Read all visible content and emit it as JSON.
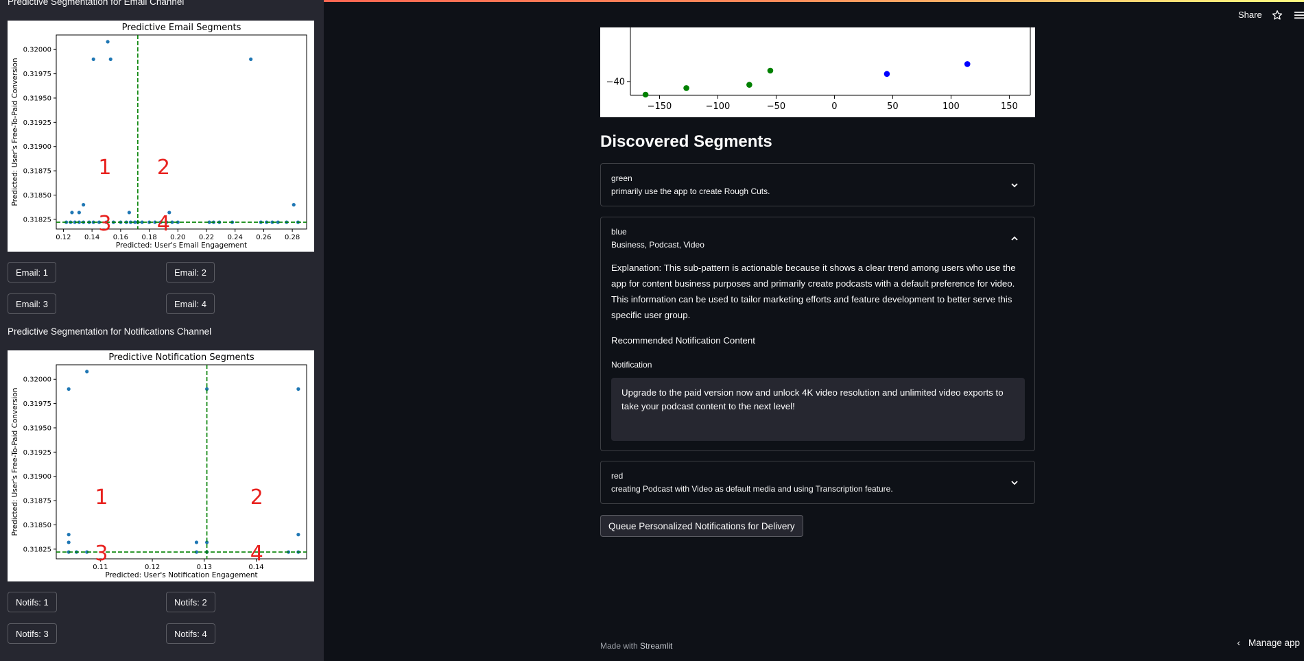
{
  "sidebar": {
    "email_title": "Predictive Segmentation for Email Channel",
    "notif_title": "Predictive Segmentation for Notifications Channel",
    "email_buttons": [
      "Email: 1",
      "Email: 2",
      "Email: 3",
      "Email: 4"
    ],
    "notif_buttons": [
      "Notifs: 1",
      "Notifs: 2",
      "Notifs: 3",
      "Notifs: 4"
    ]
  },
  "header": {
    "share_label": "Share",
    "star_icon": "star-icon",
    "menu_icon": "hamburger-menu-icon"
  },
  "main": {
    "heading": "Discovered Segments",
    "segments": [
      {
        "name": "green",
        "summary": "primarily use the app to create Rough Cuts.",
        "expanded": false
      },
      {
        "name": "blue",
        "summary": "Business, Podcast, Video",
        "expanded": true,
        "explanation": "Explanation: This sub-pattern is actionable because it shows a clear trend among users who use the app for content business purposes and primarily create podcasts with a default preference for video. This information can be used to tailor marketing efforts and feature development to better serve this specific user group.",
        "recommended_label": "Recommended Notification Content",
        "notification_label": "Notification",
        "notification_text": " Upgrade to the paid version now and unlock 4K video resolution and unlimited video exports to take your podcast content to the next level!"
      },
      {
        "name": "red",
        "summary": "creating Podcast with Video as default media and using Transcription feature.",
        "expanded": false
      }
    ],
    "queue_button": "Queue Personalized Notifications for Delivery"
  },
  "footer": {
    "made_with": "Made with",
    "brand": "Streamlit",
    "manage_app": "Manage app"
  },
  "chart_data": [
    {
      "type": "scatter",
      "title": "Predictive Email Segments",
      "xlabel": "Predicted: User's Email Engagement",
      "ylabel": "Predicted: User's Free-To-Paid Conversion",
      "xlim": [
        0.115,
        0.29
      ],
      "ylim": [
        0.31815,
        0.32015
      ],
      "xticks": [
        0.12,
        0.14,
        0.16,
        0.18,
        0.2,
        0.22,
        0.24,
        0.26,
        0.28
      ],
      "xtick_labels": [
        "0.12",
        "0.14",
        "0.16",
        "0.18",
        "0.20",
        "0.22",
        "0.24",
        "0.26",
        "0.28"
      ],
      "yticks": [
        0.31825,
        0.3185,
        0.31875,
        0.319,
        0.31925,
        0.3195,
        0.31975,
        0.32
      ],
      "ytick_labels": [
        "0.31825",
        "0.31850",
        "0.31875",
        "0.31900",
        "0.31925",
        "0.31950",
        "0.31975",
        "0.32000"
      ],
      "vline": 0.172,
      "hline": 0.31822,
      "quadrant_labels": [
        {
          "text": "1",
          "x": 0.149,
          "y": 0.3188
        },
        {
          "text": "2",
          "x": 0.19,
          "y": 0.3188
        },
        {
          "text": "3",
          "x": 0.149,
          "y": 0.31822
        },
        {
          "text": "4",
          "x": 0.19,
          "y": 0.31822
        }
      ],
      "points": [
        [
          0.141,
          0.3199
        ],
        [
          0.151,
          0.32008
        ],
        [
          0.153,
          0.3199
        ],
        [
          0.251,
          0.3199
        ],
        [
          0.126,
          0.31832
        ],
        [
          0.131,
          0.31832
        ],
        [
          0.134,
          0.3184
        ],
        [
          0.166,
          0.31832
        ],
        [
          0.194,
          0.31832
        ],
        [
          0.281,
          0.3184
        ],
        [
          0.122,
          0.31822
        ],
        [
          0.125,
          0.31822
        ],
        [
          0.128,
          0.31822
        ],
        [
          0.131,
          0.31822
        ],
        [
          0.134,
          0.31822
        ],
        [
          0.138,
          0.31822
        ],
        [
          0.141,
          0.31822
        ],
        [
          0.145,
          0.31822
        ],
        [
          0.15,
          0.31822
        ],
        [
          0.155,
          0.31822
        ],
        [
          0.16,
          0.31822
        ],
        [
          0.164,
          0.31822
        ],
        [
          0.167,
          0.31822
        ],
        [
          0.17,
          0.31822
        ],
        [
          0.172,
          0.31822
        ],
        [
          0.175,
          0.31822
        ],
        [
          0.18,
          0.31822
        ],
        [
          0.184,
          0.31822
        ],
        [
          0.188,
          0.31822
        ],
        [
          0.192,
          0.31822
        ],
        [
          0.196,
          0.31822
        ],
        [
          0.2,
          0.31822
        ],
        [
          0.222,
          0.31822
        ],
        [
          0.225,
          0.31822
        ],
        [
          0.229,
          0.31822
        ],
        [
          0.238,
          0.31822
        ],
        [
          0.258,
          0.31822
        ],
        [
          0.262,
          0.31822
        ],
        [
          0.266,
          0.31822
        ],
        [
          0.27,
          0.31822
        ],
        [
          0.276,
          0.31822
        ],
        [
          0.284,
          0.31822
        ]
      ]
    },
    {
      "type": "scatter",
      "title": "Predictive Notification Segments",
      "xlabel": "Predicted: User's Notification Engagement",
      "ylabel": "Predicted: User's Free-To-Paid Conversion",
      "xlim": [
        0.1015,
        0.1497
      ],
      "ylim": [
        0.31815,
        0.32015
      ],
      "xticks": [
        0.11,
        0.12,
        0.13,
        0.14
      ],
      "xtick_labels": [
        "0.11",
        "0.12",
        "0.13",
        "0.14"
      ],
      "yticks": [
        0.31825,
        0.3185,
        0.31875,
        0.319,
        0.31925,
        0.3195,
        0.31975,
        0.32
      ],
      "ytick_labels": [
        "0.31825",
        "0.31850",
        "0.31875",
        "0.31900",
        "0.31925",
        "0.31950",
        "0.31975",
        "0.32000"
      ],
      "vline": 0.1305,
      "hline": 0.31822,
      "quadrant_labels": [
        {
          "text": "1",
          "x": 0.1102,
          "y": 0.3188
        },
        {
          "text": "2",
          "x": 0.1401,
          "y": 0.3188
        },
        {
          "text": "3",
          "x": 0.1102,
          "y": 0.31822
        },
        {
          "text": "4",
          "x": 0.1401,
          "y": 0.31822
        }
      ],
      "points": [
        [
          0.1039,
          0.3199
        ],
        [
          0.1074,
          0.32008
        ],
        [
          0.1305,
          0.3199
        ],
        [
          0.1481,
          0.3199
        ],
        [
          0.1039,
          0.3184
        ],
        [
          0.1039,
          0.31832
        ],
        [
          0.1285,
          0.31832
        ],
        [
          0.1305,
          0.31832
        ],
        [
          0.1481,
          0.3184
        ],
        [
          0.1039,
          0.31822
        ],
        [
          0.1054,
          0.31822
        ],
        [
          0.1074,
          0.31822
        ],
        [
          0.1285,
          0.31822
        ],
        [
          0.1305,
          0.31822
        ],
        [
          0.1462,
          0.31822
        ],
        [
          0.1481,
          0.31822
        ]
      ]
    },
    {
      "type": "scatter",
      "title": "",
      "xlabel": "",
      "ylabel": "",
      "xticks": [
        -150,
        -100,
        -50,
        0,
        50,
        100,
        150
      ],
      "xtick_labels": [
        "−150",
        "−100",
        "−50",
        "0",
        "50",
        "100",
        "150"
      ],
      "yticks": [
        -40
      ],
      "ytick_labels": [
        "−40"
      ],
      "partial": true,
      "series": [
        {
          "color": "#008000",
          "points": [
            [
              -162,
              -52
            ],
            [
              -127,
              -46
            ],
            [
              -73,
              -43
            ],
            [
              -55,
              -30
            ]
          ]
        },
        {
          "color": "#0000ff",
          "points": [
            [
              45,
              -33
            ],
            [
              114,
              -24
            ]
          ]
        }
      ]
    }
  ]
}
